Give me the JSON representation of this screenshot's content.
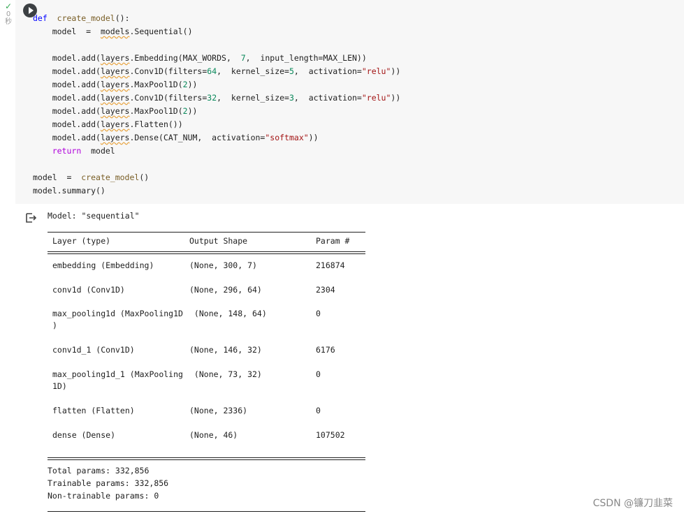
{
  "status": {
    "check": "✓",
    "count": "0",
    "unit": "秒"
  },
  "code": {
    "lines": [
      "def  create_model():",
      "    model  =  models.Sequential()",
      "",
      "    model.add(layers.Embedding(MAX_WORDS,  7,  input_length=MAX_LEN))",
      "    model.add(layers.Conv1D(filters=64,  kernel_size=5,  activation=\"relu\"))",
      "    model.add(layers.MaxPool1D(2))",
      "    model.add(layers.Conv1D(filters=32,  kernel_size=3,  activation=\"relu\"))",
      "    model.add(layers.MaxPool1D(2))",
      "    model.add(layers.Flatten())",
      "    model.add(layers.Dense(CAT_NUM,  activation=\"softmax\"))",
      "    return  model",
      "",
      "model  =  create_model()",
      "model.summary()"
    ]
  },
  "output": {
    "model_title": "Model: \"sequential\"",
    "headers": {
      "layer": "Layer (type)",
      "shape": "Output Shape",
      "params": "Param #"
    },
    "rows": [
      {
        "layer": "embedding (Embedding)",
        "layer2": "",
        "shape": "(None, 300, 7)",
        "params": "216874"
      },
      {
        "layer": "conv1d (Conv1D)",
        "layer2": "",
        "shape": "(None, 296, 64)",
        "params": "2304"
      },
      {
        "layer": "max_pooling1d (MaxPooling1D",
        "layer2": ")",
        "shape": " (None, 148, 64)",
        "params": "0"
      },
      {
        "layer": "conv1d_1 (Conv1D)",
        "layer2": "",
        "shape": "(None, 146, 32)",
        "params": "6176"
      },
      {
        "layer": "max_pooling1d_1 (MaxPooling",
        "layer2": "1D)",
        "shape": " (None, 73, 32)",
        "params": "0"
      },
      {
        "layer": "flatten (Flatten)",
        "layer2": "",
        "shape": "(None, 2336)",
        "params": "0"
      },
      {
        "layer": "dense (Dense)",
        "layer2": "",
        "shape": "(None, 46)",
        "params": "107502"
      }
    ],
    "total": "Total params: 332,856",
    "trainable": "Trainable params: 332,856",
    "non_trainable": "Non-trainable params: 0"
  },
  "watermark": "CSDN @镰刀韭菜"
}
